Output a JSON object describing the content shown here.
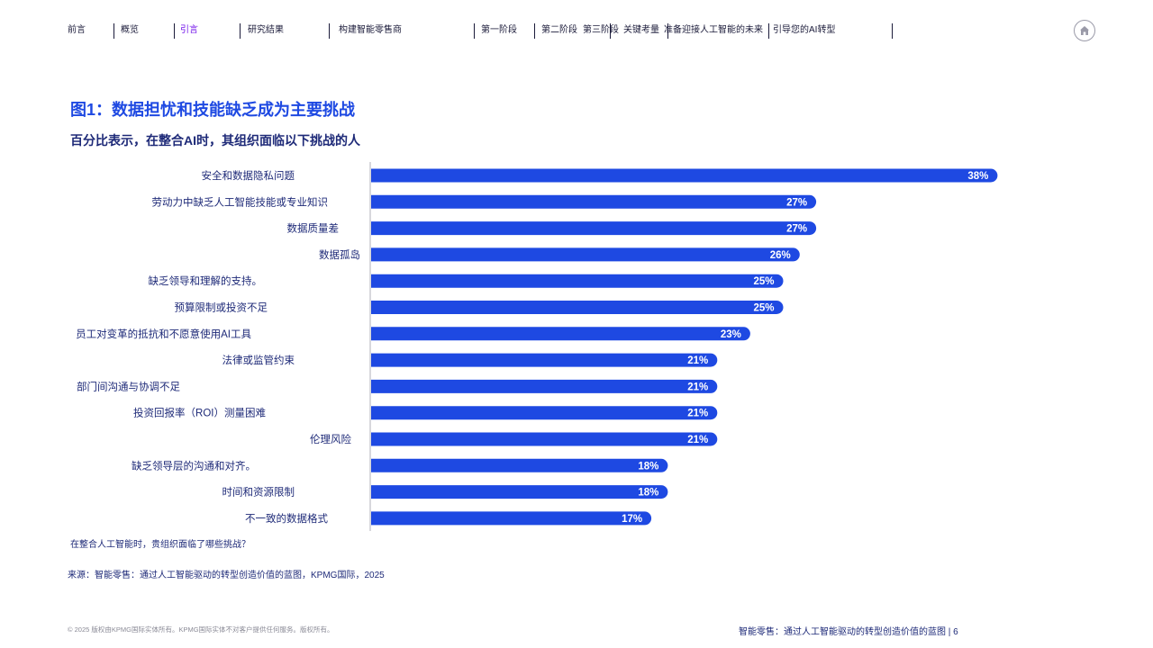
{
  "nav": {
    "items": [
      "前言",
      "概览",
      "引言",
      "研究结果",
      "构建智能零售商",
      "第一阶段",
      "第二阶段",
      "第三阶段",
      "关键考量",
      "准备迎接人工智能的未来",
      "引导您的AI转型"
    ],
    "active_index": 2,
    "active_color": "#7213ea"
  },
  "home_icon": "home-icon",
  "figure": {
    "title": "图1：数据担忧和技能缺乏成为主要挑战",
    "subtitle": "百分比表示，在整合AI时，其组织面临以下挑战的人"
  },
  "chart_data": {
    "type": "bar",
    "orientation": "horizontal",
    "categories": [
      "安全和数据隐私问题",
      "劳动力中缺乏人工智能技能或专业知识",
      "数据质量差",
      "数据孤岛",
      "缺乏领导和理解的支持。",
      "预算限制或投资不足",
      "员工对变革的抵抗和不愿意使用AI工具",
      "法律或监管约束",
      "部门间沟通与协调不足",
      "投资回报率（ROI）测量困难",
      "伦理风险",
      "缺乏领导层的沟通和对齐。",
      "时间和资源限制",
      "不一致的数据格式"
    ],
    "values": [
      38,
      27,
      27,
      26,
      25,
      25,
      23,
      21,
      21,
      21,
      21,
      18,
      18,
      17
    ],
    "value_suffix": "%",
    "xlim": [
      0,
      40
    ],
    "grid": false,
    "bar_color": "#1e49e2"
  },
  "question": "在整合人工智能时，贵组织面临了哪些挑战？",
  "source": "来源：智能零售：通过人工智能驱动的转型创造价值的蓝图，KPMG国际，2025",
  "footer": {
    "left": "© 2025 版权由KPMG国际实体所有。KPMG国际实体不对客户提供任何服务。版权所有。",
    "right": "智能零售：通过人工智能驱动的转型创造价值的蓝图 | 6"
  }
}
